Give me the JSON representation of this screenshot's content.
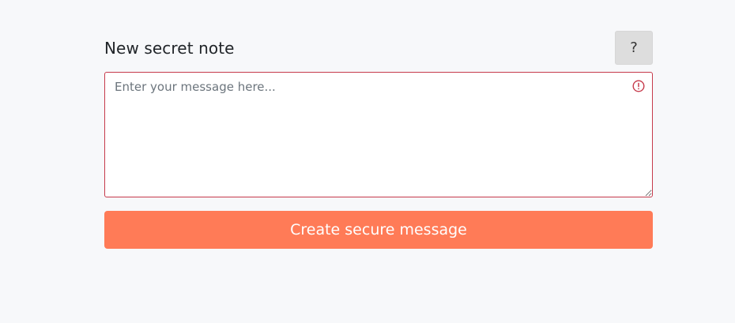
{
  "header": {
    "title": "New secret note",
    "help_label": "?"
  },
  "message_field": {
    "placeholder": "Enter your message here...",
    "value": "",
    "validation_icon": "exclamation-circle-icon",
    "invalid": true
  },
  "submit": {
    "label": "Create secure message"
  },
  "colors": {
    "background": "#f7f8fa",
    "accent": "#ff7b57",
    "error": "#c63a4b"
  }
}
